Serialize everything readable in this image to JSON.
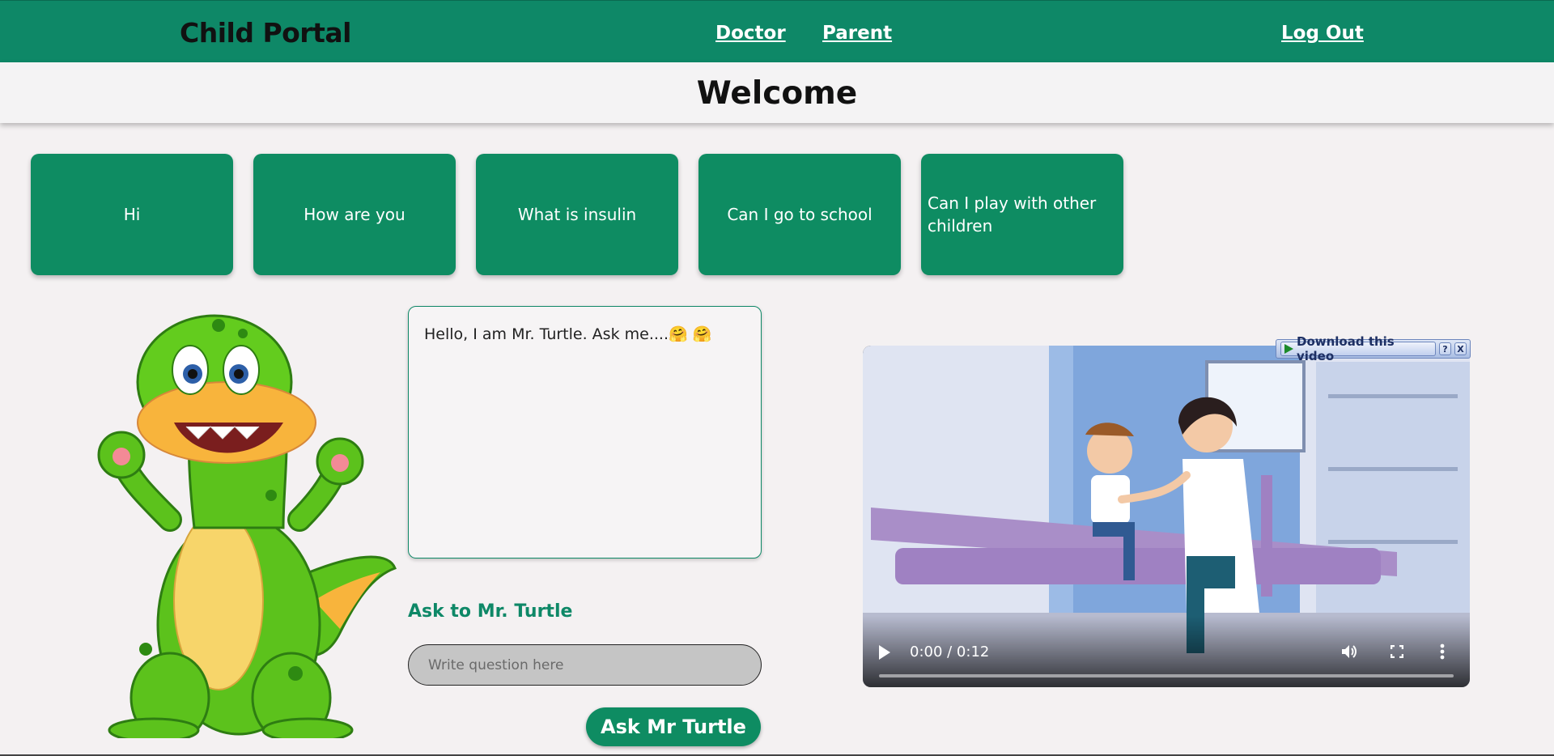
{
  "header": {
    "brand": "Child Portal",
    "nav": {
      "doctor": "Doctor",
      "parent": "Parent",
      "logout": "Log Out"
    }
  },
  "welcome": "Welcome",
  "quick_questions": [
    "Hi",
    "How are you",
    "What is insulin",
    "Can I go to school",
    "Can I play with other children"
  ],
  "chat": {
    "message": "Hello, I am Mr. Turtle. Ask me....🤗 🤗"
  },
  "ask": {
    "label": "Ask to Mr. Turtle",
    "placeholder": "Write question here",
    "button": "Ask Mr Turtle"
  },
  "video": {
    "timecode": "0:00 / 0:12",
    "download_label": "Download this video",
    "help": "?",
    "close": "X"
  },
  "colors": {
    "primary": "#0e8867",
    "button": "#0e8c62",
    "background": "#f4f1f2"
  }
}
